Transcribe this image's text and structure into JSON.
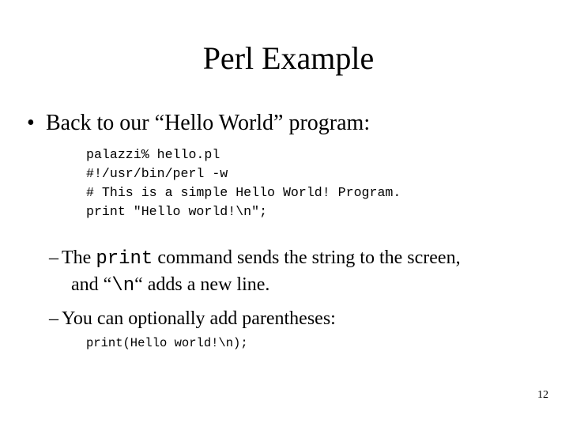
{
  "slide": {
    "title": "Perl Example",
    "bullet": {
      "symbol": "•",
      "text": "Back to our “Hello World” program:"
    },
    "code_lines": [
      "palazzi% hello.pl",
      "#!/usr/bin/perl -w",
      "# This is a simple Hello World! Program.",
      "print \"Hello world!\\n\";"
    ],
    "sub_bullets": [
      {
        "dash": "–",
        "pre": "The ",
        "code": "print",
        "post": " command sends the string to the screen,",
        "line2_pre": "and “",
        "line2_code": "\\n",
        "line2_post": "“ adds a new line."
      },
      {
        "dash": "–",
        "text": "You can optionally add parentheses:"
      }
    ],
    "code2": "print(Hello world!\\n);",
    "page_number": "12"
  }
}
